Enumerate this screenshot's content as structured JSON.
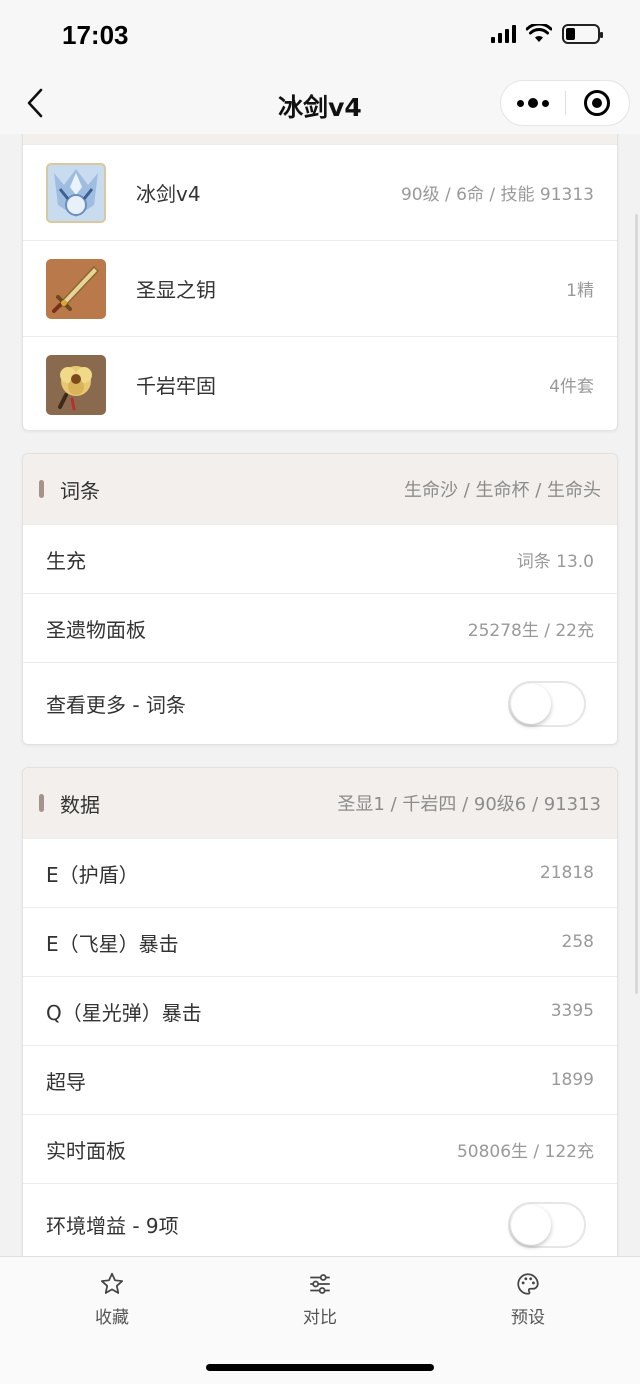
{
  "status_bar": {
    "time": "17:03"
  },
  "nav": {
    "title": "冰剑v4"
  },
  "build": {
    "items": [
      {
        "name": "冰剑v4",
        "meta": "90级 / 6命 / 技能 91313",
        "icon": "character-avatar-icon"
      },
      {
        "name": "圣显之钥",
        "meta": "1精",
        "icon": "sword-weapon-icon"
      },
      {
        "name": "千岩牢固",
        "meta": "4件套",
        "icon": "artifact-flower-icon"
      }
    ]
  },
  "substats": {
    "title": "词条",
    "summary": "生命沙 / 生命杯 / 生命头",
    "rows": [
      {
        "label": "生充",
        "value": "词条 13.0"
      },
      {
        "label": "圣遗物面板",
        "value": "25278生 / 22充"
      }
    ],
    "toggle_label": "查看更多 - 词条"
  },
  "data": {
    "title": "数据",
    "summary": "圣显1 / 千岩四 / 90级6 / 91313",
    "rows": [
      {
        "label": "E（护盾）",
        "value": "21818"
      },
      {
        "label": "E（飞星）暴击",
        "value": "258"
      },
      {
        "label": "Q（星光弹）暴击",
        "value": "3395"
      },
      {
        "label": "超导",
        "value": "1899"
      },
      {
        "label": "实时面板",
        "value": "50806生 / 122充"
      }
    ],
    "toggle_label": "环境增益 - 9项"
  },
  "tabs": [
    {
      "label": "收藏",
      "icon": "star-icon"
    },
    {
      "label": "对比",
      "icon": "sliders-icon"
    },
    {
      "label": "预设",
      "icon": "palette-icon"
    }
  ],
  "colors": {
    "header_bg": "#f3efec",
    "header_bar": "#a6928a"
  }
}
